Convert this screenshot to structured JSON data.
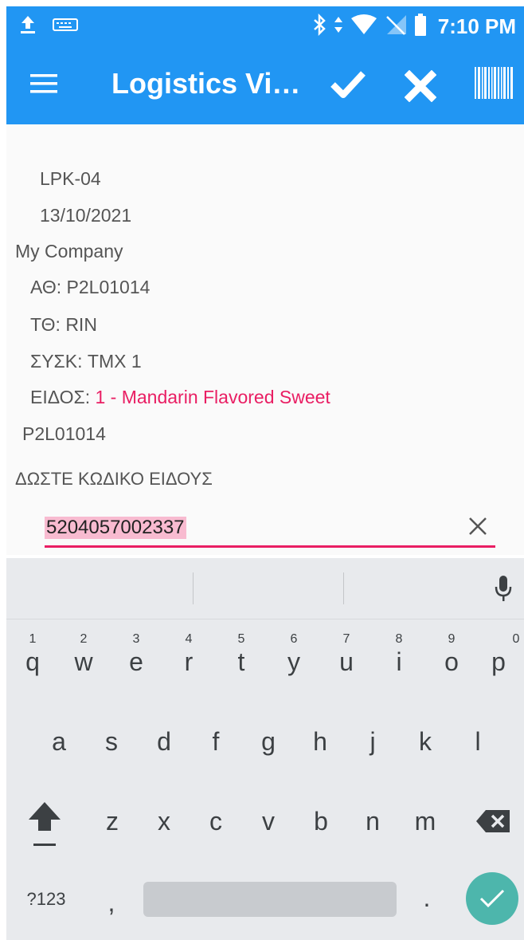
{
  "status_bar": {
    "time": "7:10 PM"
  },
  "app_bar": {
    "title": "Logistics Vi…"
  },
  "details": {
    "code": "LPK-04",
    "date": "13/10/2021",
    "company": "My Company",
    "ath_label": "ΑΘ:",
    "ath_value": "P2L01014",
    "tth_label": "ΤΘ:",
    "tth_value": "RIN",
    "sysk_label": "ΣΥΣΚ:",
    "sysk_value": "TMX 1",
    "eidos_label": "ΕΙΔΟΣ:",
    "eidos_value": "1 - Mandarin Flavored Sweet",
    "ref": "P2L01014",
    "prompt": "ΔΩΣΤΕ ΚΩΔΙΚΟ ΕΙΔΟΥΣ"
  },
  "input": {
    "value": "5204057002337"
  },
  "keyboard": {
    "row1": [
      "q",
      "w",
      "e",
      "r",
      "t",
      "y",
      "u",
      "i",
      "o",
      "p"
    ],
    "row1_hints": [
      "1",
      "2",
      "3",
      "4",
      "5",
      "6",
      "7",
      "8",
      "9",
      "0"
    ],
    "row2": [
      "a",
      "s",
      "d",
      "f",
      "g",
      "h",
      "j",
      "k",
      "l"
    ],
    "row3": [
      "z",
      "x",
      "c",
      "v",
      "b",
      "n",
      "m"
    ],
    "symbols_label": "?123",
    "comma": ",",
    "period": "."
  },
  "colors": {
    "primary": "#2196f3",
    "accent": "#e91e63",
    "enter": "#4db6ac"
  }
}
